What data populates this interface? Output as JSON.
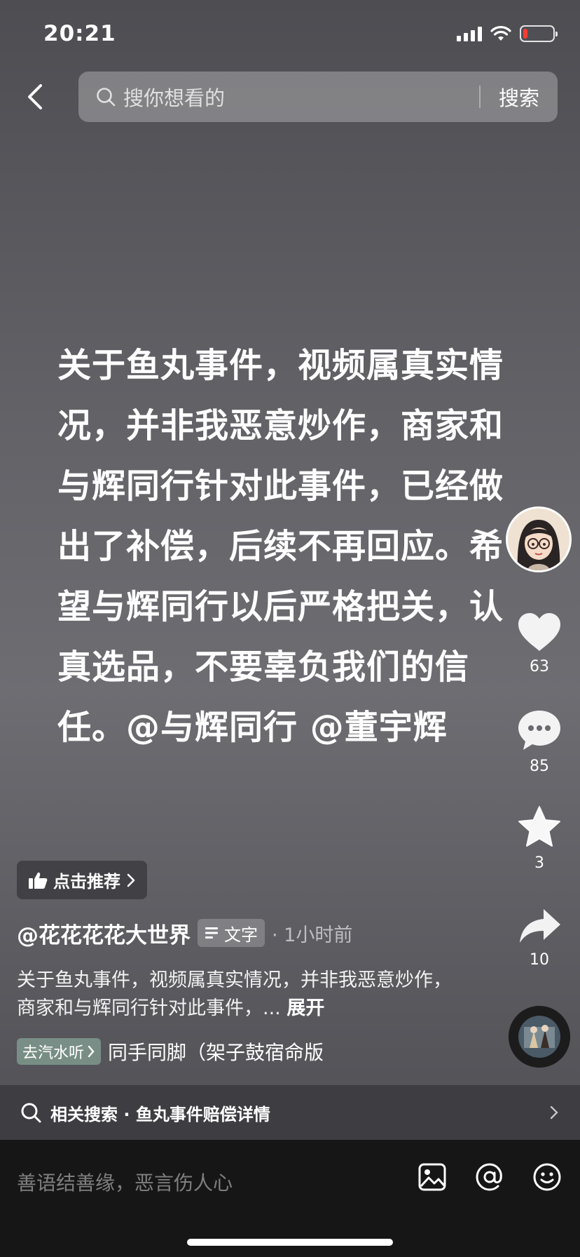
{
  "status_bar": {
    "time": "20:21",
    "battery_level": 0.15
  },
  "header": {
    "search_placeholder": "搜你想看的",
    "search_button": "搜索"
  },
  "post": {
    "main_text": "关于鱼丸事件，视频属真实情况，并非我恶意炒作，商家和与辉同行针对此事件，已经做出了补偿，后续不再回应。希望与辉同行以后严格把关，认真选品，不要辜负我们的信任。@与辉同行 @董宇辉",
    "recommend_label": "点击推荐",
    "author": "@花花花花大世界",
    "type_badge": "文字",
    "time_ago": "· 1小时前",
    "description": "关于鱼丸事件，视频属真实情况，并非我恶意炒作，商家和与辉同行针对此事件，...",
    "expand_label": "展开",
    "music_chip": "去汽水听",
    "music_title": "同手同脚（架子鼓宿命版"
  },
  "actions": {
    "likes": "63",
    "comments": "85",
    "favorites": "3",
    "shares": "10"
  },
  "related": {
    "label": "相关搜索 · 鱼丸事件赔偿详情"
  },
  "comment": {
    "placeholder": "善语结善缘，恶言伤人心"
  },
  "colors": {
    "battery_low": "#ff3b30",
    "music_chip": "#7fa894"
  }
}
